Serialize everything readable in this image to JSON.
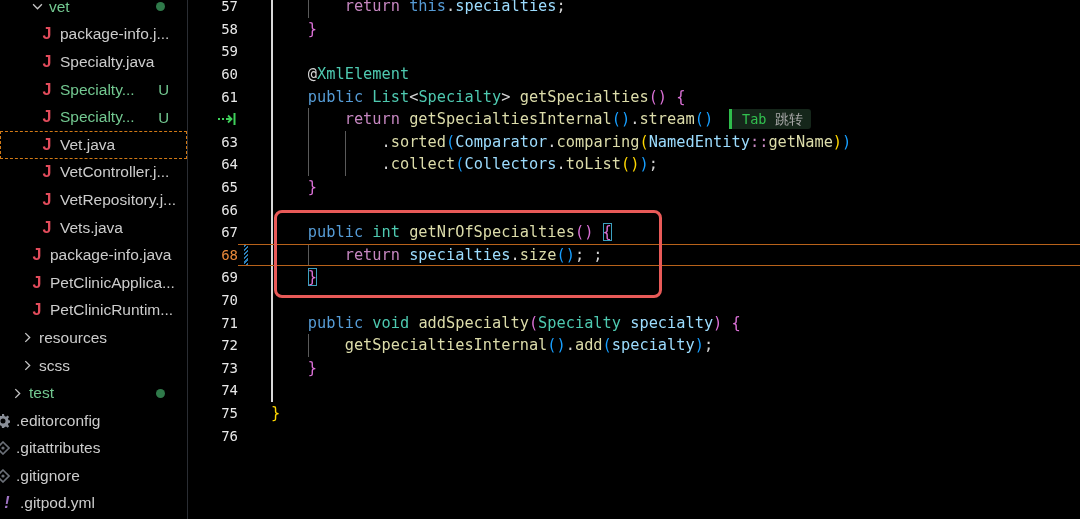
{
  "explorer": {
    "items": [
      {
        "children": [
          {
            "children": [
              {
                "children": [
                  {
                    "label": "vet",
                    "kind": "folder",
                    "expanded": true,
                    "untracked": true,
                    "dot": true,
                    "children": [
                      {
                        "label": "package-info.j...",
                        "kind": "java",
                        "icon": "J",
                        "untracked": false,
                        "selected": false
                      },
                      {
                        "label": "Specialty.java",
                        "kind": "java",
                        "icon": "J",
                        "untracked": false,
                        "selected": false
                      },
                      {
                        "label": "Specialty...",
                        "kind": "java",
                        "icon": "J",
                        "untracked": true,
                        "badge": "U",
                        "selected": false
                      },
                      {
                        "label": "Specialty...",
                        "kind": "java",
                        "icon": "J",
                        "untracked": true,
                        "badge": "U",
                        "selected": false
                      },
                      {
                        "label": "Vet.java",
                        "kind": "java",
                        "icon": "J",
                        "untracked": false,
                        "selected": true
                      },
                      {
                        "label": "VetController.j...",
                        "kind": "java",
                        "icon": "J",
                        "untracked": false,
                        "selected": false
                      },
                      {
                        "label": "VetRepository.j...",
                        "kind": "java",
                        "icon": "J",
                        "untracked": false,
                        "selected": false
                      },
                      {
                        "label": "Vets.java",
                        "kind": "java",
                        "icon": "J",
                        "untracked": false,
                        "selected": false
                      }
                    ]
                  },
                  {
                    "label": "package-info.java",
                    "kind": "java",
                    "icon": "J",
                    "untracked": false,
                    "selected": false
                  },
                  {
                    "label": "PetClinicApplica...",
                    "kind": "java",
                    "icon": "J",
                    "untracked": false,
                    "selected": false
                  },
                  {
                    "label": "PetClinicRuntim...",
                    "kind": "java",
                    "icon": "J",
                    "untracked": false,
                    "selected": false
                  }
                ]
              },
              {
                "label": "resources",
                "kind": "folder",
                "expanded": false,
                "untracked": false,
                "dot": false
              },
              {
                "label": "scss",
                "kind": "folder",
                "expanded": false,
                "untracked": false,
                "dot": false
              }
            ]
          },
          {
            "label": "test",
            "kind": "folder",
            "expanded": false,
            "untracked": true,
            "dot": true
          }
        ]
      },
      {
        "label": ".editorconfig",
        "kind": "config",
        "untracked": false,
        "selected": false
      },
      {
        "label": ".gitattributes",
        "kind": "git",
        "untracked": false,
        "selected": false
      },
      {
        "label": ".gitignore",
        "kind": "git",
        "untracked": false,
        "selected": false
      },
      {
        "label": ".gitpod.yml",
        "kind": "yaml",
        "icon": "!",
        "untracked": false,
        "selected": false
      }
    ]
  },
  "editor": {
    "lines": [
      {
        "number": "57",
        "tokens": [
          {
            "t": "        return ",
            "kind": "control"
          },
          {
            "t": "this",
            "kind": "keyword"
          },
          {
            "t": ".",
            "kind": "plain"
          },
          {
            "t": "specialties",
            "kind": "variable"
          },
          {
            "t": ";",
            "kind": "plain"
          }
        ]
      },
      {
        "number": "58",
        "tokens": [
          {
            "t": "    }",
            "kind": "bracket2"
          }
        ]
      },
      {
        "number": "59"
      },
      {
        "number": "60",
        "tokens": [
          {
            "t": "    @",
            "kind": "plain"
          },
          {
            "t": "XmlElement",
            "kind": "type"
          }
        ]
      },
      {
        "number": "61",
        "tokens": [
          {
            "t": "    public ",
            "kind": "keyword"
          },
          {
            "t": "List",
            "kind": "type"
          },
          {
            "t": "<",
            "kind": "plain"
          },
          {
            "t": "Specialty",
            "kind": "type"
          },
          {
            "t": "> ",
            "kind": "plain"
          },
          {
            "t": "getSpecialties",
            "kind": "function"
          },
          {
            "t": "() ",
            "kind": "bracket2"
          },
          {
            "t": "{",
            "kind": "bracket2"
          }
        ]
      },
      {
        "jump_target": true,
        "tokens": [
          {
            "t": "        return ",
            "kind": "control"
          },
          {
            "t": "getSpecialtiesInternal",
            "kind": "function"
          },
          {
            "t": "()",
            "kind": "bracket3"
          },
          {
            "t": ".",
            "kind": "plain"
          },
          {
            "t": "stream",
            "kind": "function"
          },
          {
            "t": "()",
            "kind": "bracket3"
          }
        ],
        "hint": {
          "key": "Tab",
          "label": "跳转"
        }
      },
      {
        "number": "63",
        "tokens": [
          {
            "t": "            .",
            "kind": "plain"
          },
          {
            "t": "sorted",
            "kind": "function"
          },
          {
            "t": "(",
            "kind": "bracket3"
          },
          {
            "t": "Comparator",
            "kind": "variable"
          },
          {
            "t": ".",
            "kind": "plain"
          },
          {
            "t": "comparing",
            "kind": "function"
          },
          {
            "t": "(",
            "kind": "bracket1"
          },
          {
            "t": "NamedEntity",
            "kind": "variable"
          },
          {
            "t": "::",
            "kind": "control"
          },
          {
            "t": "getName",
            "kind": "function"
          },
          {
            "t": ")",
            "kind": "bracket1"
          },
          {
            "t": ")",
            "kind": "bracket3"
          }
        ]
      },
      {
        "number": "64",
        "tokens": [
          {
            "t": "            .",
            "kind": "plain"
          },
          {
            "t": "collect",
            "kind": "function"
          },
          {
            "t": "(",
            "kind": "bracket3"
          },
          {
            "t": "Collectors",
            "kind": "variable"
          },
          {
            "t": ".",
            "kind": "plain"
          },
          {
            "t": "toList",
            "kind": "function"
          },
          {
            "t": "()",
            "kind": "bracket1"
          },
          {
            "t": ")",
            "kind": "bracket3"
          },
          {
            "t": ";",
            "kind": "plain"
          }
        ]
      },
      {
        "number": "65",
        "tokens": [
          {
            "t": "    }",
            "kind": "bracket2"
          }
        ]
      },
      {
        "number": "66"
      },
      {
        "number": "67",
        "highlighted": true,
        "tokens": [
          {
            "t": "    public ",
            "kind": "keyword"
          },
          {
            "t": "int ",
            "kind": "type"
          },
          {
            "t": "getNrOfSpecialties",
            "kind": "function"
          },
          {
            "t": "() ",
            "kind": "bracket2"
          },
          {
            "t": "{",
            "kind": "bracket2",
            "match": true
          }
        ]
      },
      {
        "number": "68",
        "highlighted": true,
        "current": true,
        "changed": true,
        "tokens": [
          {
            "t": "        return ",
            "kind": "control"
          },
          {
            "t": "specialties",
            "kind": "variable"
          },
          {
            "t": ".",
            "kind": "plain"
          },
          {
            "t": "size",
            "kind": "function"
          },
          {
            "t": "()",
            "kind": "bracket3"
          },
          {
            "t": "; ;",
            "kind": "plain"
          }
        ]
      },
      {
        "number": "69",
        "highlighted": true,
        "tokens": [
          {
            "t": "    }",
            "kind": "bracket2",
            "match": true
          }
        ]
      },
      {
        "number": "70"
      },
      {
        "number": "71",
        "tokens": [
          {
            "t": "    public ",
            "kind": "keyword"
          },
          {
            "t": "void ",
            "kind": "type"
          },
          {
            "t": "addSpecialty",
            "kind": "function"
          },
          {
            "t": "(",
            "kind": "bracket2"
          },
          {
            "t": "Specialty ",
            "kind": "type"
          },
          {
            "t": "specialty",
            "kind": "variable"
          },
          {
            "t": ") ",
            "kind": "bracket2"
          },
          {
            "t": "{",
            "kind": "bracket2"
          }
        ]
      },
      {
        "number": "72",
        "tokens": [
          {
            "t": "        getSpecialtiesInternal",
            "kind": "function"
          },
          {
            "t": "()",
            "kind": "bracket3"
          },
          {
            "t": ".",
            "kind": "plain"
          },
          {
            "t": "add",
            "kind": "function"
          },
          {
            "t": "(",
            "kind": "bracket3"
          },
          {
            "t": "specialty",
            "kind": "variable"
          },
          {
            "t": ")",
            "kind": "bracket3"
          },
          {
            "t": ";",
            "kind": "plain"
          }
        ]
      },
      {
        "number": "73",
        "tokens": [
          {
            "t": "    }",
            "kind": "bracket2"
          }
        ]
      },
      {
        "number": "74"
      },
      {
        "number": "75",
        "tokens": [
          {
            "t": "}",
            "kind": "bracket1"
          }
        ]
      },
      {
        "number": "76"
      }
    ]
  }
}
